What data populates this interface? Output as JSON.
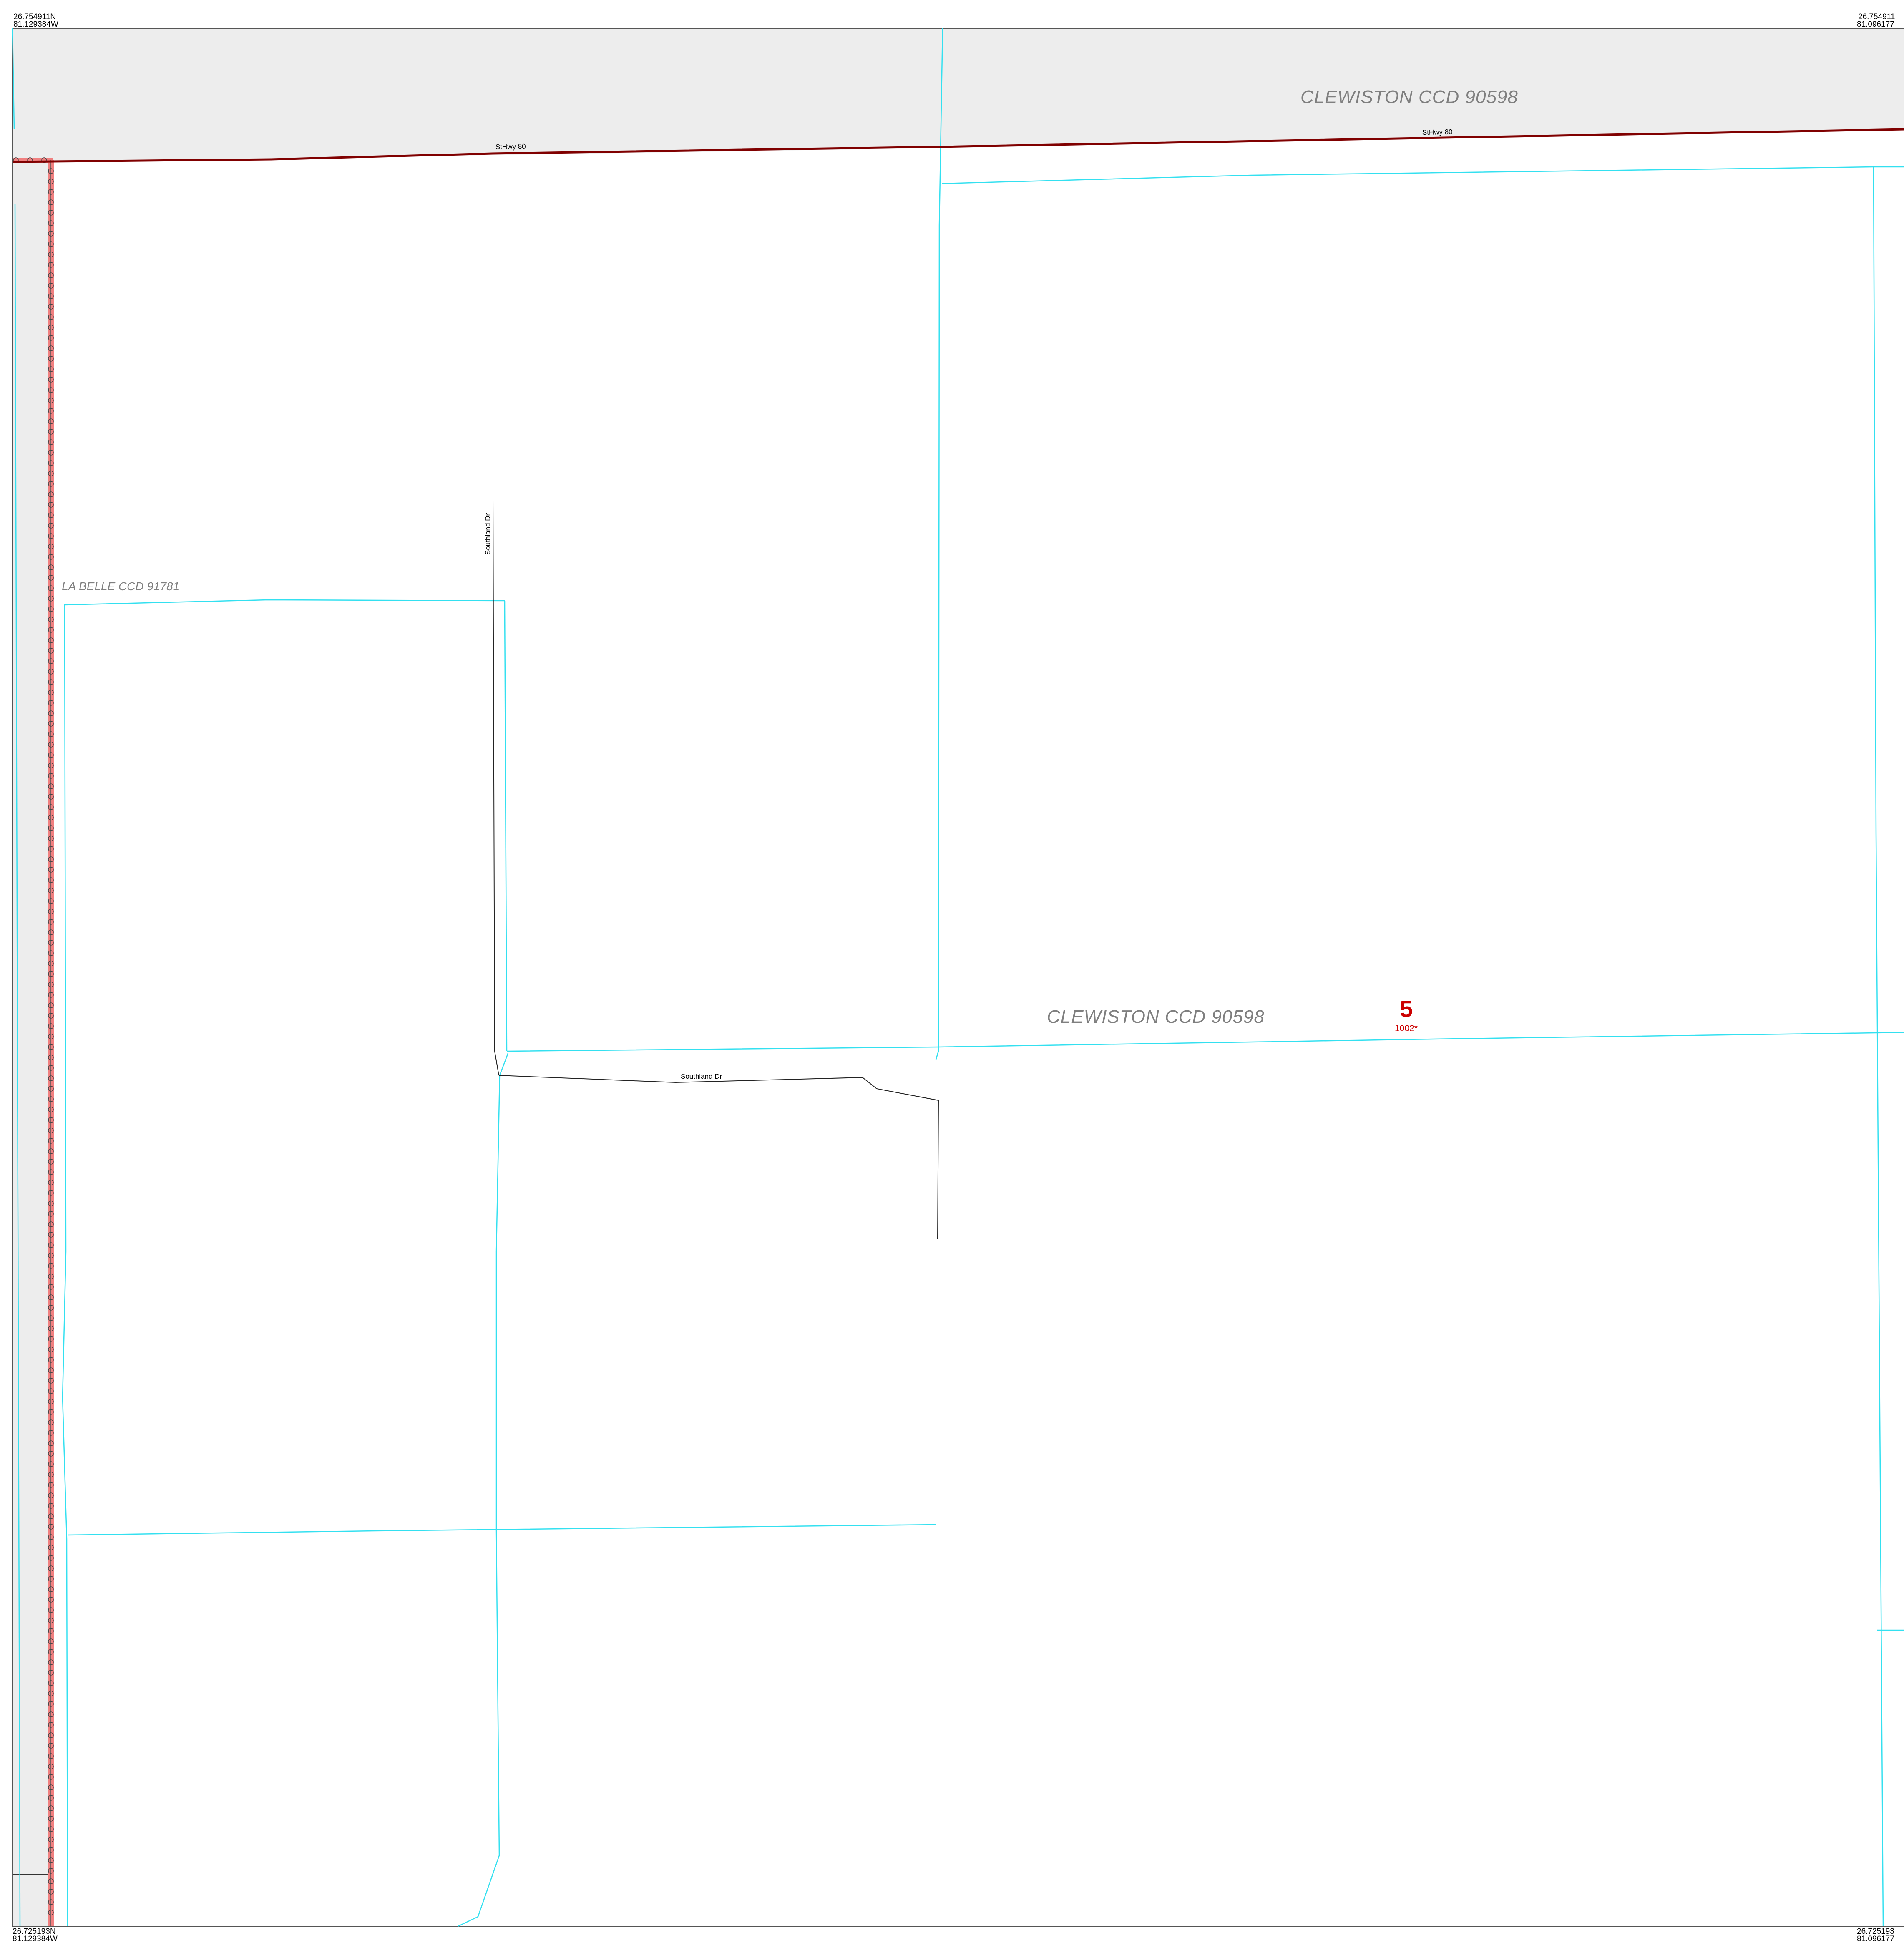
{
  "map": {
    "corners": {
      "top_left": {
        "lat": "26.754911N",
        "lon": "81.129384W"
      },
      "top_right": {
        "lat": "26.754911",
        "lon": "81.096177"
      },
      "bottom_left": {
        "lat": "26.725193N",
        "lon": "81.129384W"
      },
      "bottom_right": {
        "lat": "26.725193",
        "lon": "81.096177"
      }
    },
    "areas": [
      {
        "name": "CLEWISTON CCD 90598"
      },
      {
        "name": "CLEWISTON CCD 90598"
      },
      {
        "name": "LA BELLE CCD 91781"
      }
    ],
    "roads": [
      {
        "name": "StHwy 80"
      },
      {
        "name": "StHwy 80"
      },
      {
        "name": "Southland Dr"
      },
      {
        "name": "Southland Dr"
      }
    ],
    "block": {
      "number": "5",
      "code": "1002*"
    },
    "colors": {
      "ccd_fill": "#ededed",
      "highway": "#800000",
      "block_line": "#33e0f0",
      "county_boundary": "#f08080",
      "label_gray": "#7f7f7f",
      "block_label": "#cc0000"
    }
  }
}
